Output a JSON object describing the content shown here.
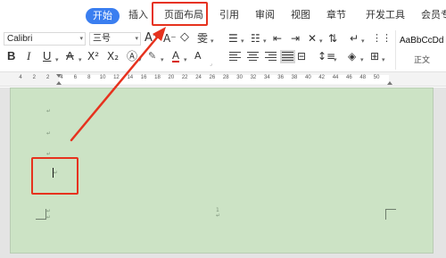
{
  "menu": {
    "tabs": [
      {
        "label": "开始",
        "active": true
      },
      {
        "label": "插入"
      },
      {
        "label": "页面布局"
      },
      {
        "label": "引用"
      },
      {
        "label": "审阅"
      },
      {
        "label": "视图"
      },
      {
        "label": "章节"
      },
      {
        "label": "开发工具"
      },
      {
        "label": "会员专"
      }
    ]
  },
  "ribbon": {
    "font_name": "Calibri",
    "font_size": "三号",
    "style_sample": "AaBbCcDd",
    "style_name": "正文",
    "icons": {
      "bold": "B",
      "italic": "I",
      "underline": "U",
      "strikethrough": "A",
      "superscript": "X²",
      "subscript": "X₂",
      "font_color": "A",
      "grow_font": "A⁺",
      "shrink_font": "A⁻",
      "phonetic": "雯"
    }
  },
  "ruler": {
    "numbers": [
      "4",
      "2",
      "2",
      "4",
      "6",
      "8",
      "10",
      "12",
      "14",
      "16",
      "18",
      "20",
      "22",
      "24",
      "26",
      "28",
      "30",
      "32",
      "34",
      "36",
      "38",
      "40",
      "42",
      "44",
      "46",
      "48",
      "50"
    ]
  },
  "document": {
    "paragraph_mark": "↵",
    "page_number": "1"
  },
  "colors": {
    "accent": "#3a7ef0",
    "page_bg": "#cce3c5",
    "annotation": "#e6321e"
  }
}
